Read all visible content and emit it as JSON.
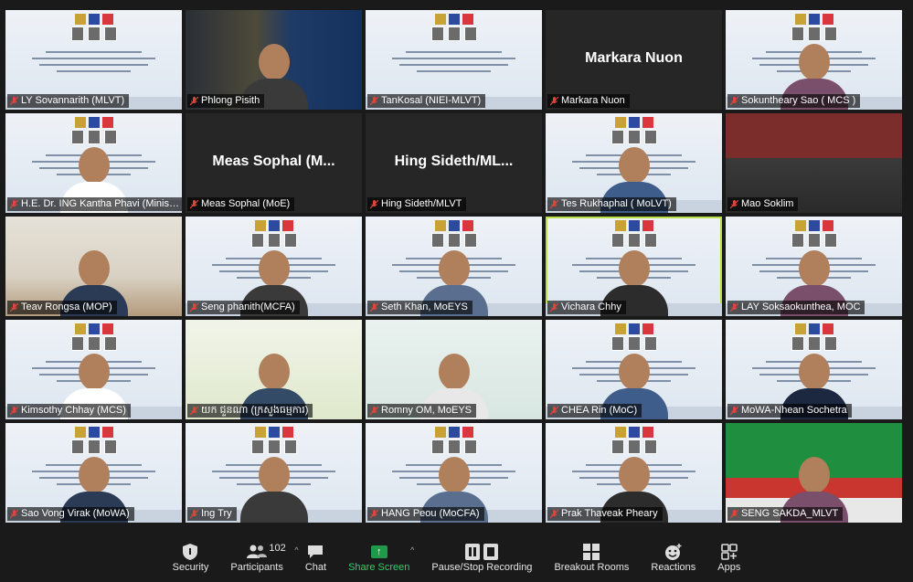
{
  "participants_tiles": [
    {
      "name": "LY Sovannarith (MLVT)",
      "style": "slide"
    },
    {
      "name": "Phlong Pisith",
      "style": "photo-map"
    },
    {
      "name": "TanKosal (NIEI-MLVT)",
      "style": "slide"
    },
    {
      "name": "Markara Nuon",
      "style": "name-only",
      "display_name": "Markara Nuon"
    },
    {
      "name": "Sokuntheary Sao ( MCS )",
      "style": "slide-person"
    },
    {
      "name": "H.E. Dr. ING Kantha Phavi (Ministe...",
      "style": "slide-person"
    },
    {
      "name": "Meas Sophal (MoE)",
      "style": "name-only",
      "display_name": "Meas Sophal (M..."
    },
    {
      "name": "Hing Sideth/MLVT",
      "style": "name-only",
      "display_name": "Hing Sideth/ML..."
    },
    {
      "name": "Tes Rukhaphal ( MoLVT)",
      "style": "slide-person"
    },
    {
      "name": "Mao Soklim",
      "style": "room"
    },
    {
      "name": "Teav Rongsa (MOP)",
      "style": "room-person"
    },
    {
      "name": "Seng phanith(MCFA)",
      "style": "slide-person"
    },
    {
      "name": "Seth Khan, MoEYS",
      "style": "slide-person"
    },
    {
      "name": "Vichara Chhy",
      "style": "slide-person",
      "active": true
    },
    {
      "name": "LAY Soksaokunthea, MOC",
      "style": "slide-person"
    },
    {
      "name": "Kimsothy Chhay (MCS)",
      "style": "slide-person"
    },
    {
      "name": "យក ជួនណា (ក្រសួងធម្មការ)",
      "style": "green-person"
    },
    {
      "name": "Romny OM, MoEYS",
      "style": "logo-person"
    },
    {
      "name": "CHEA Rin (MoC)",
      "style": "slide-person"
    },
    {
      "name": "MoWA-Nhean Sochetra",
      "style": "slide-person"
    },
    {
      "name": "Sao Vong Virak (MoWA)",
      "style": "slide-person"
    },
    {
      "name": "Ing Try",
      "style": "slide-person"
    },
    {
      "name": "HANG Peou (MoCFA)",
      "style": "slide-person"
    },
    {
      "name": "Prak Thaveak Pheary",
      "style": "slide-person"
    },
    {
      "name": "SENG SAKDA_MLVT",
      "style": "banner-person"
    }
  ],
  "toolbar": {
    "security": "Security",
    "participants": "Participants",
    "participants_count": "102",
    "chat": "Chat",
    "share_screen": "Share Screen",
    "pause_recording": "Pause/Stop Recording",
    "breakout_rooms": "Breakout Rooms",
    "reactions": "Reactions",
    "apps": "Apps"
  },
  "colors": {
    "active_speaker_border": "#b9e04a",
    "share_screen_green": "#2fd06a",
    "muted_red": "#e0453a"
  }
}
